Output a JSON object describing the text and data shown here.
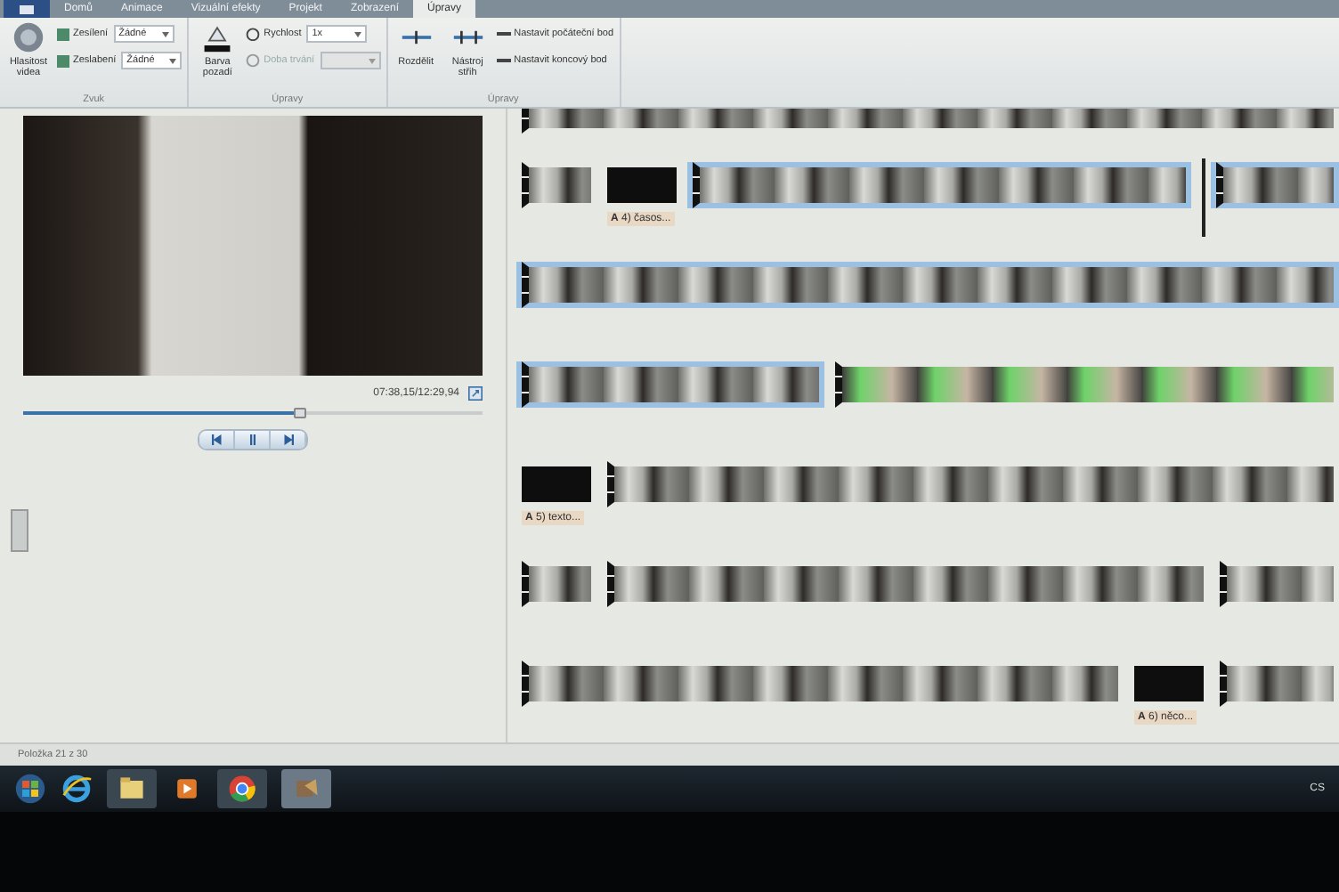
{
  "tabs": [
    {
      "label": "Domů",
      "selected": false
    },
    {
      "label": "Animace",
      "selected": false
    },
    {
      "label": "Vizuální efekty",
      "selected": false
    },
    {
      "label": "Projekt",
      "selected": false
    },
    {
      "label": "Zobrazení",
      "selected": false
    },
    {
      "label": "Úpravy",
      "selected": true
    }
  ],
  "ribbon": {
    "audio": {
      "volume_label": "Hlasitost videa",
      "fade_in_label": "Zesílení",
      "fade_in_value": "Žádné",
      "fade_out_label": "Zeslabení",
      "fade_out_value": "Žádné",
      "group_label": "Zvuk"
    },
    "adjust": {
      "background_label": "Barva pozadí",
      "speed_label": "Rychlost",
      "speed_value": "1x",
      "duration_label": "Doba trvání",
      "duration_disabled": true,
      "group_label": "Úpravy"
    },
    "edit": {
      "split_label": "Rozdělit",
      "trim_label": "Nástroj střih",
      "start_label": "Nastavit počáteční bod",
      "end_label": "Nastavit koncový bod",
      "group_label": "Úpravy"
    }
  },
  "player": {
    "time": "07:38,15/12:29,94",
    "level": 0.6
  },
  "storyboard": [
    {
      "clips": [
        {
          "kind": "video-fill",
          "selected": false
        }
      ]
    },
    {
      "clips": [
        {
          "kind": "video-short",
          "selected": false
        },
        {
          "kind": "title",
          "selected": false,
          "caption": "**A** 4) časos..."
        },
        {
          "kind": "video-long",
          "selected": true
        },
        {
          "kind": "playhead",
          "selected": false
        },
        {
          "kind": "video-fill",
          "selected": true
        }
      ]
    },
    {
      "clips": [
        {
          "kind": "video-fill",
          "selected": true
        }
      ]
    },
    {
      "clips": [
        {
          "kind": "video-medium",
          "selected": true
        },
        {
          "kind": "green-fill",
          "selected": false
        }
      ]
    },
    {
      "clips": [
        {
          "kind": "title",
          "selected": false,
          "caption": "**A** 5) texto..."
        },
        {
          "kind": "video-fill",
          "selected": false
        }
      ]
    },
    {
      "clips": [
        {
          "kind": "video-short",
          "selected": false
        },
        {
          "kind": "video-longer",
          "selected": false
        },
        {
          "kind": "video-fill",
          "selected": false
        }
      ]
    },
    {
      "clips": [
        {
          "kind": "video-longer",
          "selected": false
        },
        {
          "kind": "title",
          "selected": false,
          "caption": "**A** 6) něco..."
        },
        {
          "kind": "video-fill",
          "selected": false
        }
      ]
    }
  ],
  "status_bar": {
    "text": "Položka 21 z 30"
  },
  "taskbar": {
    "language": "CS"
  }
}
